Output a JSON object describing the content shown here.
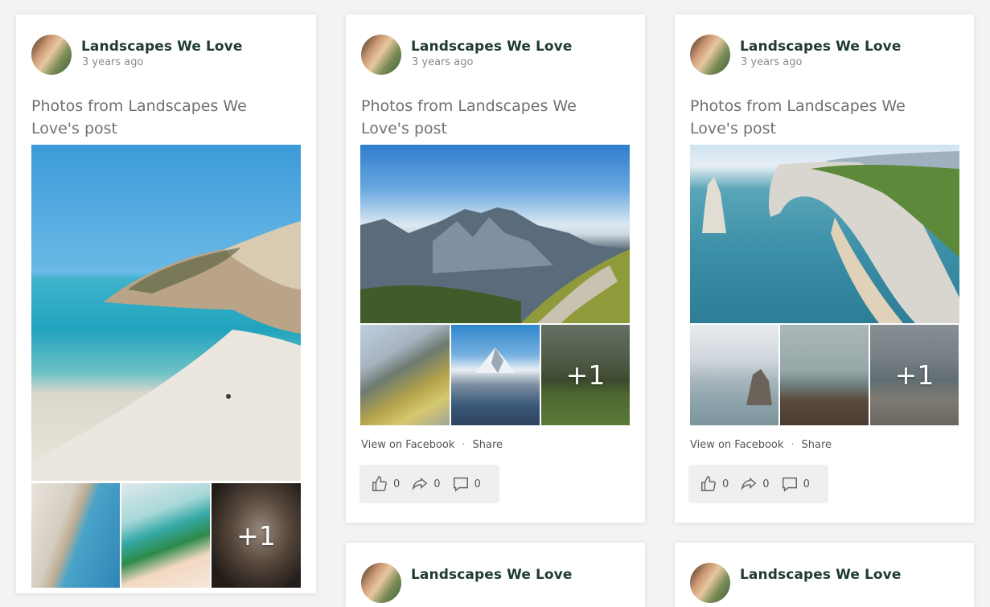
{
  "posts": [
    {
      "author": "Landscapes We Love",
      "time": "3 years ago",
      "title": "Photos from Landscapes We Love's post",
      "extra_photos": "+1"
    },
    {
      "author": "Landscapes We Love",
      "time": "3 years ago",
      "title": "Photos from Landscapes We Love's post",
      "extra_photos": "+1",
      "view_label": "View on Facebook",
      "share_label": "Share",
      "likes": "0",
      "shares": "0",
      "comments": "0"
    },
    {
      "author": "Landscapes We Love",
      "time": "3 years ago",
      "title": "Photos from Landscapes We Love's post",
      "extra_photos": "+1",
      "view_label": "View on Facebook",
      "share_label": "Share",
      "likes": "0",
      "shares": "0",
      "comments": "0"
    }
  ],
  "next_row": [
    {
      "author": "Landscapes We Love"
    },
    {
      "author": "Landscapes We Love"
    }
  ],
  "icons": [
    "thumbs-up-icon",
    "share-arrow-icon",
    "comment-icon"
  ]
}
